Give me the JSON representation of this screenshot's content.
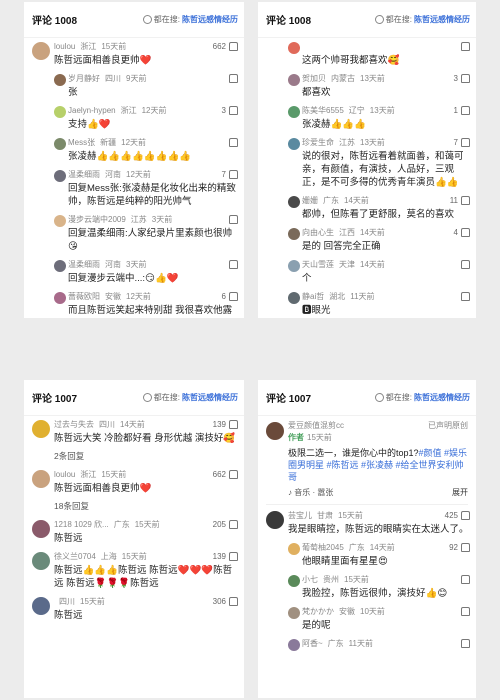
{
  "panels": [
    {
      "title": "评论 1008",
      "searching_prefix": "都在搜:",
      "searching_topic": "陈哲远感情经历",
      "comments": [
        {
          "user": "loulou",
          "loc": "浙江",
          "time": "15天前",
          "likes": "662",
          "text": "陈哲远面相善良更帅❤️",
          "avatar_color": "#c9a27e",
          "reply": false
        },
        {
          "user": "岁月静好",
          "loc": "四川",
          "time": "9天前",
          "likes": "",
          "text": "张",
          "avatar_color": "#8a6a50",
          "reply": true
        },
        {
          "user": "Jaelyn-hypen",
          "loc": "浙江",
          "time": "12天前",
          "likes": "3",
          "text": "支持👍❤️",
          "avatar_color": "#b7d06a",
          "reply": true
        },
        {
          "user": "Mess张",
          "loc": "新疆",
          "time": "12天前",
          "likes": "",
          "text": "张凌赫👍👍👍👍👍👍👍👍",
          "avatar_color": "#7b8a6a",
          "reply": true
        },
        {
          "user": "温柔细雨",
          "loc": "河南",
          "time": "12天前",
          "likes": "7",
          "text": "回复Mess张:张凌赫是化妆化出来的精致帅，陈哲远是纯粹的阳光帅气",
          "avatar_color": "#6d6d7a",
          "reply": true
        },
        {
          "user": "漫步云端中2009",
          "loc": "江苏",
          "time": "3天前",
          "likes": "",
          "text": "回复温柔细雨:人家纪录片里素颜也很帅😘",
          "avatar_color": "#d9b48a",
          "reply": true
        },
        {
          "user": "温柔细雨",
          "loc": "河南",
          "time": "3天前",
          "likes": "",
          "text": "回复漫步云端中...:😏👍❤️",
          "avatar_color": "#6d6d7a",
          "reply": true
        },
        {
          "user": "蔷薇欧阳",
          "loc": "安徽",
          "time": "12天前",
          "likes": "6",
          "text": "而且陈哲远笑起来特别甜 我很喜欢他露",
          "avatar_color": "#a86a8a",
          "reply": true
        }
      ]
    },
    {
      "title": "评论 1008",
      "searching_prefix": "都在搜:",
      "searching_topic": "陈哲远感情经历",
      "comments": [
        {
          "user": "",
          "loc": "",
          "time": "",
          "likes": "",
          "text": "这两个帅哥我都喜欢🥰",
          "avatar_color": "#e06a5a",
          "reply": true
        },
        {
          "user": "贺加贝",
          "loc": "内蒙古",
          "time": "13天前",
          "likes": "3",
          "text": "都喜欢",
          "avatar_color": "#9a7a8a",
          "reply": true
        },
        {
          "user": "陈美华6555",
          "loc": "辽宁",
          "time": "13天前",
          "likes": "1",
          "text": "张凌赫👍👍👍",
          "avatar_color": "#5a9a6a",
          "reply": true
        },
        {
          "user": "珍爱生命",
          "loc": "江苏",
          "time": "13天前",
          "likes": "7",
          "text": "说的很对，陈哲远看着就面善，和蔼可亲，有颜值，有演技，人品好，三观正，是不可多得的优秀青年演员👍👍",
          "avatar_color": "#5a8aa0",
          "reply": true
        },
        {
          "user": "姗姗",
          "loc": "广东",
          "time": "14天前",
          "likes": "11",
          "text": "都帅，但陈看了更舒服，莫名的喜欢",
          "avatar_color": "#4a4a4a",
          "reply": true
        },
        {
          "user": "向由心生",
          "loc": "江西",
          "time": "14天前",
          "likes": "4",
          "text": "是的 回答完全正确",
          "avatar_color": "#7a6a5a",
          "reply": true
        },
        {
          "user": "天山雪莲",
          "loc": "天津",
          "time": "14天前",
          "likes": "",
          "text": "个",
          "avatar_color": "#8aa0b0",
          "reply": true
        },
        {
          "user": "静ai哲",
          "loc": "湖北",
          "time": "11天前",
          "likes": "",
          "text": "🅱眼光",
          "avatar_color": "#606a70",
          "reply": true
        }
      ]
    },
    {
      "title": "评论 1007",
      "searching_prefix": "都在搜:",
      "searching_topic": "陈哲远感情经历",
      "comments": [
        {
          "user": "过去与失去",
          "loc": "四川",
          "time": "14天前",
          "likes": "139",
          "text": "陈哲远大笑 冷脸都好看 身形优越 演技好🥰",
          "avatar_color": "#e0b030",
          "reply": false,
          "replies_label": "2条回复"
        },
        {
          "user": "loulou",
          "loc": "浙江",
          "time": "15天前",
          "likes": "662",
          "text": "陈哲远面相善良更帅❤️",
          "avatar_color": "#c9a27e",
          "reply": false,
          "replies_label": "18条回复"
        },
        {
          "user": "1218 1029 欣...",
          "loc": "广东",
          "time": "15天前",
          "likes": "205",
          "text": "陈哲远",
          "avatar_color": "#8a5a6a",
          "reply": false
        },
        {
          "user": "徐义兰0704",
          "loc": "上海",
          "time": "15天前",
          "likes": "139",
          "text": "陈哲远👍👍👍陈哲远 陈哲远❤️❤️❤️陈哲远 陈哲远🌹🌹🌹陈哲远",
          "avatar_color": "#6a8a7a",
          "reply": false
        },
        {
          "user": "",
          "loc": "四川",
          "time": "15天前",
          "likes": "306",
          "text": "陈哲远",
          "avatar_color": "#5a6a8a",
          "reply": false
        }
      ]
    },
    {
      "title": "评论 1007",
      "searching_prefix": "都在搜:",
      "searching_topic": "陈哲远感情经历",
      "post": {
        "user": "爱豆颜值混剪cc",
        "badge": "作者",
        "time": "15天前",
        "claim": "已声明原创",
        "text": "极限二选一，谁是你心中的top1?",
        "hashtags": "#颜值 #娱乐圈男明星 #陈哲远 #张凌赫 #给全世界安利帅哥",
        "music": "♪ 音乐 · 嚣张",
        "expand": "展开",
        "avatar_color": "#6a4a3a"
      },
      "comments": [
        {
          "user": "芸宝儿",
          "loc": "甘肃",
          "time": "15天前",
          "likes": "425",
          "text": "我是眼睛控，陈哲远的眼睛实在太迷人了。",
          "avatar_color": "#3a3a3a",
          "reply": false
        },
        {
          "user": "葡萄柚2045",
          "loc": "广东",
          "time": "14天前",
          "likes": "92",
          "text": "他眼睛里面有星星😍",
          "avatar_color": "#e0b060",
          "reply": true
        },
        {
          "user": "小七",
          "loc": "贵州",
          "time": "15天前",
          "likes": "",
          "text": "我脸控，陈哲远很帅，演技好👍😊",
          "avatar_color": "#5a8a5a",
          "reply": true
        },
        {
          "user": "梵かかか",
          "loc": "安徽",
          "time": "10天前",
          "likes": "",
          "text": "是的呢",
          "avatar_color": "#a09080",
          "reply": true
        },
        {
          "user": "阿香~",
          "loc": "广东",
          "time": "11天前",
          "likes": "",
          "text": "",
          "avatar_color": "#8a7a9a",
          "reply": true
        }
      ]
    }
  ]
}
